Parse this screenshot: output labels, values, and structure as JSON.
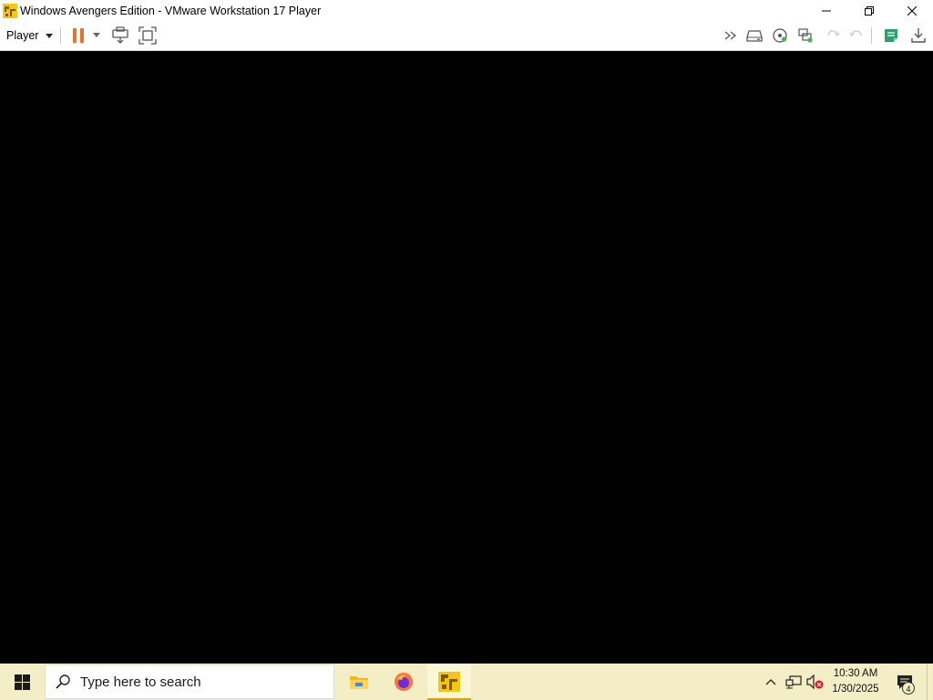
{
  "window": {
    "title": "Windows Avengers Edition - VMware Workstation 17 Player",
    "app_icon": "vmware-icon",
    "controls": [
      "minimize-icon",
      "restore-icon",
      "close-icon"
    ]
  },
  "toolbar": {
    "player_menu_label": "Player",
    "left_buttons": [
      "pause-icon",
      "dropdown-arrow-icon",
      "send-ctrl-alt-del-icon",
      "fullscreen-icon"
    ],
    "right_buttons": [
      "forward-icon",
      "removable-device-icon",
      "cd-drive-icon",
      "network-adapter-icon",
      "unity-icon",
      "unity-alt-icon",
      "notes-icon",
      "download-icon"
    ],
    "accent_color": "#e8742c"
  },
  "vm_screen": {
    "background": "#000000"
  },
  "taskbar": {
    "background": "#f3eec5",
    "start_icon": "windows-start-icon",
    "search_placeholder": "Type here to search",
    "apps": [
      {
        "name": "file-explorer-icon",
        "active": false
      },
      {
        "name": "firefox-icon",
        "active": false
      },
      {
        "name": "vmware-icon",
        "active": true
      }
    ],
    "tray_icons": [
      "chevron-up-icon",
      "network-icon",
      "volume-muted-icon"
    ],
    "time": "10:30 AM",
    "date": "1/30/2025",
    "notification_count": "4"
  }
}
